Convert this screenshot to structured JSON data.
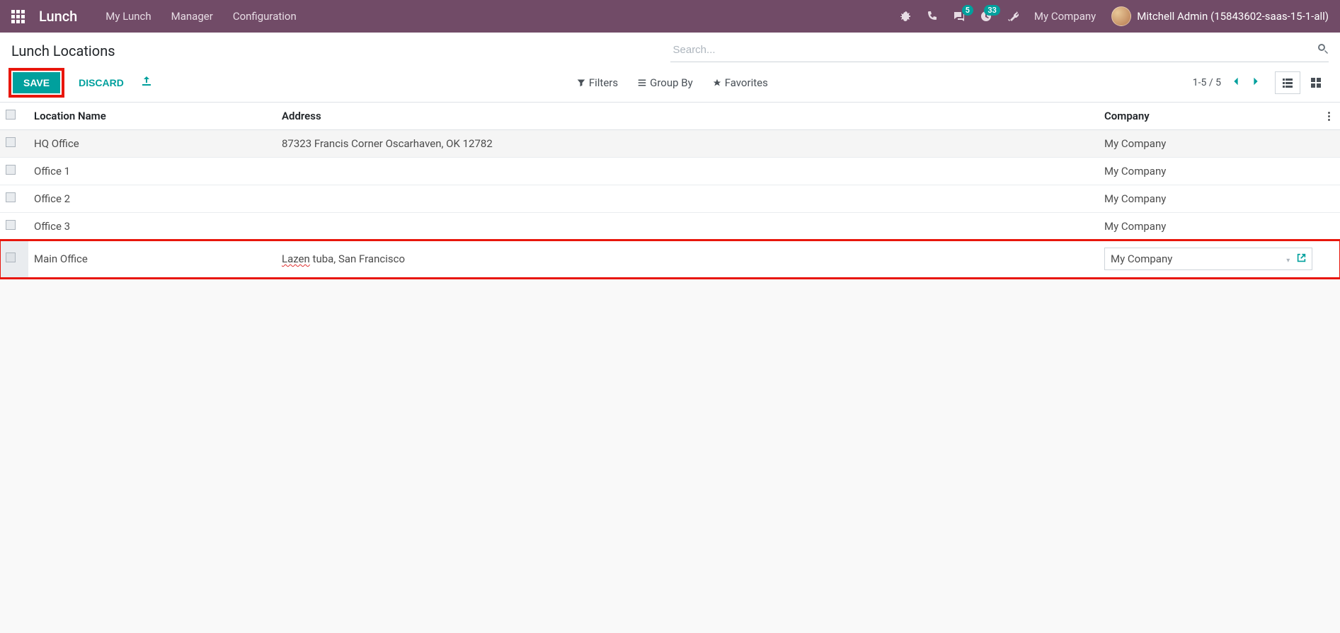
{
  "navbar": {
    "brand": "Lunch",
    "menu": [
      "My Lunch",
      "Manager",
      "Configuration"
    ],
    "messages_badge": "5",
    "activities_badge": "33",
    "company": "My Company",
    "user": "Mitchell Admin (15843602-saas-15-1-all)"
  },
  "breadcrumb": "Lunch Locations",
  "buttons": {
    "save": "SAVE",
    "discard": "DISCARD"
  },
  "search": {
    "placeholder": "Search..."
  },
  "filters": {
    "filters": "Filters",
    "groupby": "Group By",
    "favorites": "Favorites"
  },
  "pager": "1-5 / 5",
  "columns": {
    "location": "Location Name",
    "address": "Address",
    "company": "Company"
  },
  "rows": [
    {
      "name": "HQ Office",
      "address": "87323 Francis Corner Oscarhaven, OK 12782",
      "company": "My Company"
    },
    {
      "name": "Office 1",
      "address": "",
      "company": "My Company"
    },
    {
      "name": "Office 2",
      "address": "",
      "company": "My Company"
    },
    {
      "name": "Office 3",
      "address": "",
      "company": "My Company"
    }
  ],
  "edit_row": {
    "name": "Main Office",
    "address_span1": "Lazen",
    "address_span2": " tuba, San Francisco",
    "company": "My Company"
  }
}
